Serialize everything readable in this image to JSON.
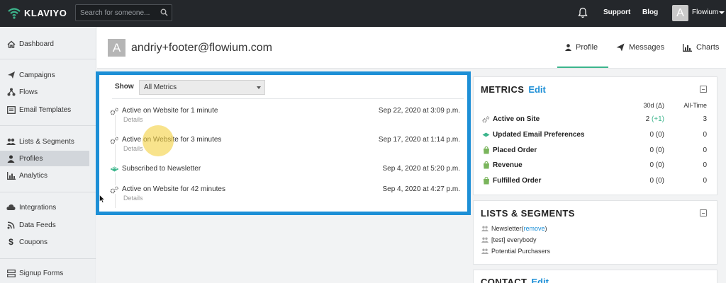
{
  "app": {
    "brand": "KLAVIYO",
    "search_placeholder": "Search for someone...",
    "nav": {
      "support": "Support",
      "blog": "Blog"
    },
    "user": {
      "initial": "A",
      "name": "Flowium"
    }
  },
  "sidebar": {
    "items": [
      {
        "label": "Dashboard",
        "icon": "home-icon"
      },
      {
        "label": "Campaigns",
        "icon": "paper-plane-icon"
      },
      {
        "label": "Flows",
        "icon": "flow-icon"
      },
      {
        "label": "Email Templates",
        "icon": "template-icon"
      },
      {
        "label": "Lists & Segments",
        "icon": "users-icon"
      },
      {
        "label": "Profiles",
        "icon": "user-icon",
        "active": true
      },
      {
        "label": "Analytics",
        "icon": "bar-chart-icon"
      },
      {
        "label": "Integrations",
        "icon": "cloud-icon"
      },
      {
        "label": "Data Feeds",
        "icon": "rss-icon"
      },
      {
        "label": "Coupons",
        "icon": "dollar-icon"
      },
      {
        "label": "Signup Forms",
        "icon": "form-icon"
      }
    ]
  },
  "profile": {
    "initial": "A",
    "email": "andriy+footer@flowium.com",
    "tabs": {
      "profile": "Profile",
      "messages": "Messages",
      "charts": "Charts"
    }
  },
  "feed": {
    "show_label": "Show",
    "filter": "All Metrics",
    "events": [
      {
        "title": "Active on Website for 1 minute",
        "details": "Details",
        "date": "Sep 22, 2020 at 3:09 p.m.",
        "icon": "gears-icon"
      },
      {
        "title": "Active on Website for 3 minutes",
        "details": "Details",
        "date": "Sep 17, 2020 at 1:14 p.m.",
        "icon": "gears-icon"
      },
      {
        "title": "Subscribed to Newsletter",
        "details": "",
        "date": "Sep 4, 2020 at 5:20 p.m.",
        "icon": "klaviyo-flag-icon"
      },
      {
        "title": "Active on Website for 42 minutes",
        "details": "Details",
        "date": "Sep 4, 2020 at 4:27 p.m.",
        "icon": "gears-icon"
      }
    ]
  },
  "metrics": {
    "title": "METRICS",
    "edit": "Edit",
    "col_30d": "30d (Δ)",
    "col_all": "All-Time",
    "rows": [
      {
        "label": "Active on Site",
        "value_30d": "2",
        "delta": "(+1)",
        "all_time": "3",
        "icon": "gears-icon"
      },
      {
        "label": "Updated Email Preferences",
        "value_30d": "0 (0)",
        "delta": "",
        "all_time": "0",
        "icon": "klaviyo-flag-icon"
      },
      {
        "label": "Placed Order",
        "value_30d": "0 (0)",
        "delta": "",
        "all_time": "0",
        "icon": "shopify-bag-icon"
      },
      {
        "label": "Revenue",
        "value_30d": "0 (0)",
        "delta": "",
        "all_time": "0",
        "icon": "shopify-bag-icon"
      },
      {
        "label": "Fulfilled Order",
        "value_30d": "0 (0)",
        "delta": "",
        "all_time": "0",
        "icon": "shopify-bag-icon"
      }
    ]
  },
  "lists": {
    "title": "LISTS & SEGMENTS",
    "items": [
      {
        "label": "Newsletter",
        "remove_open": " (",
        "remove": "remove",
        "remove_close": ")"
      },
      {
        "label": "[test] everybody"
      },
      {
        "label": "Potential Purchasers"
      }
    ]
  },
  "contact": {
    "title": "CONTACT",
    "edit": "Edit"
  },
  "colors": {
    "accent_blue": "#1d8fd6",
    "accent_green": "#3cb58c",
    "topbar": "#24272b"
  }
}
